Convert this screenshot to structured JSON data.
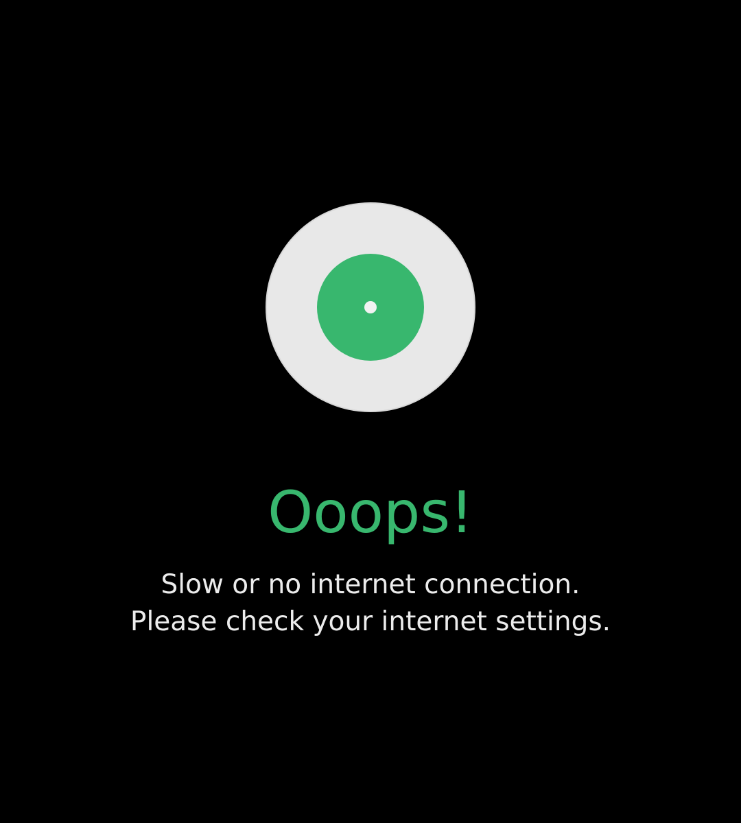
{
  "error": {
    "icon": "vinyl-disc-icon",
    "title": "Ooops!",
    "message_lines": [
      "Slow or no internet connection.",
      "Please check your internet settings."
    ]
  },
  "colors": {
    "background": "#000000",
    "accent": "#38b76e",
    "disc": "#e8e8e8",
    "text": "#ececec"
  }
}
